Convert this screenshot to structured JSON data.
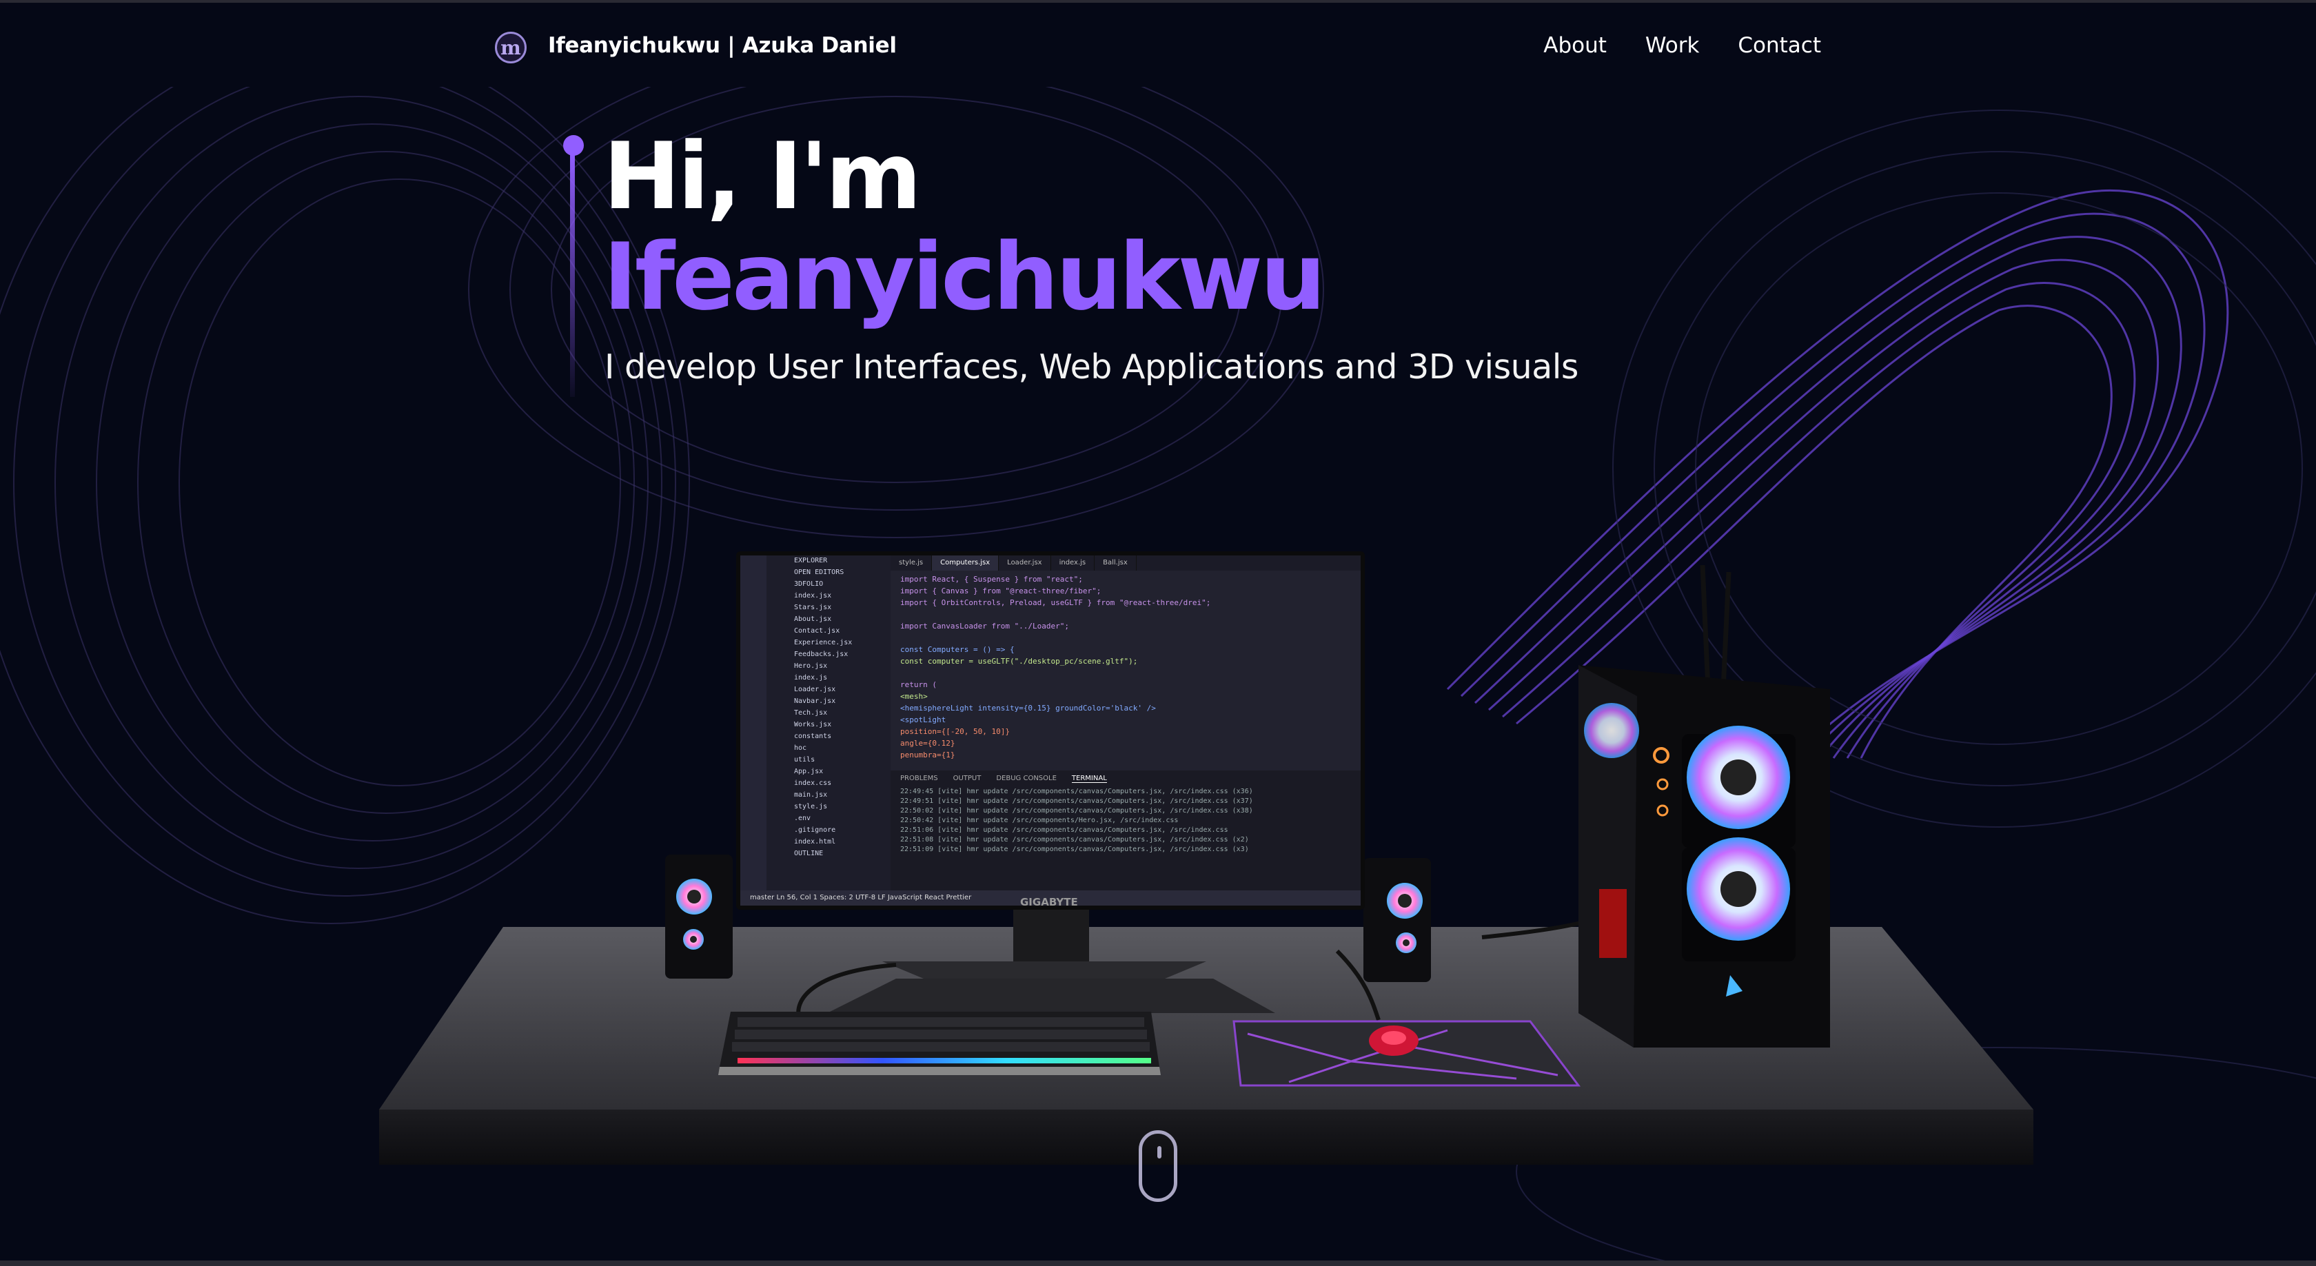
{
  "nav": {
    "logo_glyph": "m",
    "brand": "Ifeanyichukwu | Azuka Daniel",
    "links": [
      "About",
      "Work",
      "Contact"
    ]
  },
  "hero": {
    "greeting": "Hi, I'm",
    "name": "Ifeanyichukwu",
    "tagline": "I develop User Interfaces, Web Applications and 3D visuals"
  },
  "editor": {
    "tabs": [
      "style.js",
      "Computers.jsx",
      "Loader.jsx",
      "index.js",
      "Ball.jsx"
    ],
    "active_tab": "Computers.jsx",
    "explorer": [
      "EXPLORER",
      "OPEN EDITORS",
      "3DFOLIO",
      "index.jsx",
      "Stars.jsx",
      "About.jsx",
      "Contact.jsx",
      "Experience.jsx",
      "Feedbacks.jsx",
      "Hero.jsx",
      "index.js",
      "Loader.jsx",
      "Navbar.jsx",
      "Tech.jsx",
      "Works.jsx",
      "constants",
      "hoc",
      "utils",
      "App.jsx",
      "index.css",
      "main.jsx",
      "style.js",
      ".env",
      ".gitignore",
      "index.html",
      "OUTLINE"
    ],
    "code": [
      "import React, { Suspense } from \"react\";",
      "import { Canvas } from \"@react-three/fiber\";",
      "import { OrbitControls, Preload, useGLTF } from \"@react-three/drei\";",
      "",
      "import CanvasLoader from \"../Loader\";",
      "",
      "const Computers = () => {",
      "  const computer = useGLTF(\"./desktop_pc/scene.gltf\");",
      "",
      "  return (",
      "    <mesh>",
      "      <hemisphereLight intensity={0.15} groundColor='black' />",
      "      <spotLight",
      "        position={[-20, 50, 10]}",
      "        angle={0.12}",
      "        penumbra={1}"
    ],
    "terminal_tabs": [
      "PROBLEMS",
      "OUTPUT",
      "DEBUG CONSOLE",
      "TERMINAL"
    ],
    "terminal_lines": [
      "22:49:45 [vite] hmr update /src/components/canvas/Computers.jsx, /src/index.css (x36)",
      "22:49:51 [vite] hmr update /src/components/canvas/Computers.jsx, /src/index.css (x37)",
      "22:50:02 [vite] hmr update /src/components/canvas/Computers.jsx, /src/index.css (x38)",
      "22:50:42 [vite] hmr update /src/components/Hero.jsx, /src/index.css",
      "22:51:06 [vite] hmr update /src/components/canvas/Computers.jsx, /src/index.css",
      "22:51:08 [vite] hmr update /src/components/canvas/Computers.jsx, /src/index.css (x2)",
      "22:51:09 [vite] hmr update /src/components/canvas/Computers.jsx, /src/index.css (x3)"
    ],
    "status": "master   Ln 56, Col 1   Spaces: 2   UTF-8   LF   JavaScript React   Prettier",
    "stand_brand": "GIGABYTE"
  },
  "colors": {
    "background": "#050816",
    "accent": "#915eff",
    "text": "#ffffff"
  }
}
